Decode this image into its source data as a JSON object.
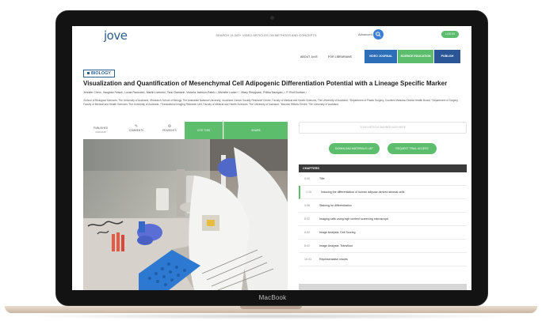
{
  "device": {
    "label": "MacBook"
  },
  "header": {
    "logo": "jove",
    "search_placeholder": "SEARCH 14,000+ VIDEO ARTICLES ON METHODS AND CONCEPTS",
    "advanced_label": "Advanced",
    "login_label": "LOG IN",
    "nav_links": [
      "ABOUT JoVE",
      "FOR LIBRARIANS"
    ],
    "nav_buttons": [
      "VIDEO JOURNAL",
      "SCIENCE EDUCATION",
      "PUBLISH"
    ]
  },
  "article": {
    "category": "BIOLOGY",
    "title": "Visualization and Quantification of Mesenchymal Cell Adipogenic Differentiation Potential with a Lineage Specific Marker",
    "authors": "Jennifer Chen¹, Vaughan Feisst¹, Lucas Ramonet¹, Martin Leemes¹, Tanu Damiani¹, Victoria Jackson-Patel²,³, Michelle Locke³,⁴, Hilary Sheppard¹, Pritika Narayan¹,³, P. Rod Dunbar¹,³",
    "affiliations": "¹School of Biological Sciences, The University of Auckland, ²Research School of Biology, The Australian National University, ³Auckland Cancer Society Research Centre, Faculty of Medical and Health Sciences, The University of Auckland, ⁴Department of Plastic Surgery, Counties Manukau District Health Board, ⁵Department of Surgery, Faculty of Medical and Health Sciences, The University of Auckland, ⁶Translational Imaging Research Unit, Faculty of Medical and Health Sciences, The University of Auckland, ⁷Maurice Wilkins Centre, The University of Auckland"
  },
  "tabs": {
    "published_label": "PUBLISHED",
    "published_date": "2/20/2020",
    "comments_label": "COMMENTS",
    "reagents_label": "REAGENTS",
    "cite_label": "CITE THIS",
    "share_label": "SHARE"
  },
  "sidebar": {
    "ad_text": "YOUR ARTICLE BANNER ADS HERE",
    "buttons": [
      "DOWNLOAD MATERIALS LIST",
      "REQUEST TRIAL ACCESS"
    ],
    "chapters_title": "CHAPTERS",
    "chapters": [
      {
        "time": "0:00",
        "name": "Title"
      },
      {
        "time": "1:15",
        "name": "Inducing the differentiation of human adipose derived stromal cells"
      },
      {
        "time": "3:36",
        "name": "Staining for differentiation"
      },
      {
        "time": "5:32",
        "name": "Imaging cells using high content screening microscope"
      },
      {
        "time": "6:52",
        "name": "Image Analysis: Cell Scoring"
      },
      {
        "time": "8:42",
        "name": "Image Analysis: Transflour"
      },
      {
        "time": "10:43",
        "name": "Representative results"
      }
    ]
  },
  "colors": {
    "accent_green": "#5cbd6d",
    "brand_blue": "#2b5f8f",
    "nav_blue": "#2d6eb8",
    "dark_header": "#3a3a3a"
  }
}
